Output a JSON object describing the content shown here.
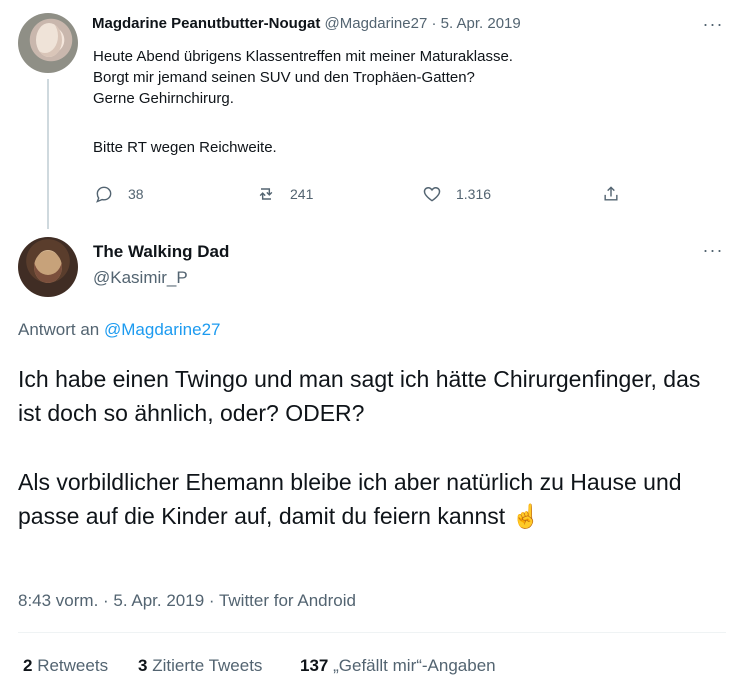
{
  "tweet1": {
    "author_name": "Magdarine Peanutbutter-Nougat",
    "handle": "@Magdarine27",
    "dot": "·",
    "date": "5. Apr. 2019",
    "more": "···",
    "lines": [
      "Heute Abend übrigens Klassentreffen mit meiner Maturaklasse.",
      "Borgt mir jemand seinen SUV und den Trophäen-Gatten?",
      "Gerne Gehirnchirurg.",
      "",
      "Bitte RT wegen Reichweite."
    ],
    "actions": {
      "replies": "38",
      "retweets": "241",
      "likes": "1.316"
    }
  },
  "tweet2": {
    "author_name": "The Walking Dad",
    "handle": "@Kasimir_P",
    "more": "···",
    "reply_prefix": "Antwort an",
    "reply_to": "@Magdarine27",
    "paragraphs": [
      "Ich habe einen Twingo und man sagt ich hätte Chirurgenfinger, das ist doch so ähnlich, oder? ODER?",
      "Als vorbildlicher Ehemann bleibe ich aber natürlich zu Hause und passe auf die Kinder auf, damit du feiern kannst ☝️"
    ],
    "timestamp": "8:43 vorm. · 5. Apr. 2019 · Twitter for Android",
    "stats": {
      "retweets_count": "2",
      "retweets_label": "Retweets",
      "quotes_count": "3",
      "quotes_label": "Zitierte Tweets",
      "likes_count": "137",
      "likes_label": "„Gefällt mir“-Angaben"
    }
  },
  "colors": {
    "text": "#0f1419",
    "muted": "#536471",
    "link": "#1d9bf0",
    "line": "#cfd9de"
  }
}
